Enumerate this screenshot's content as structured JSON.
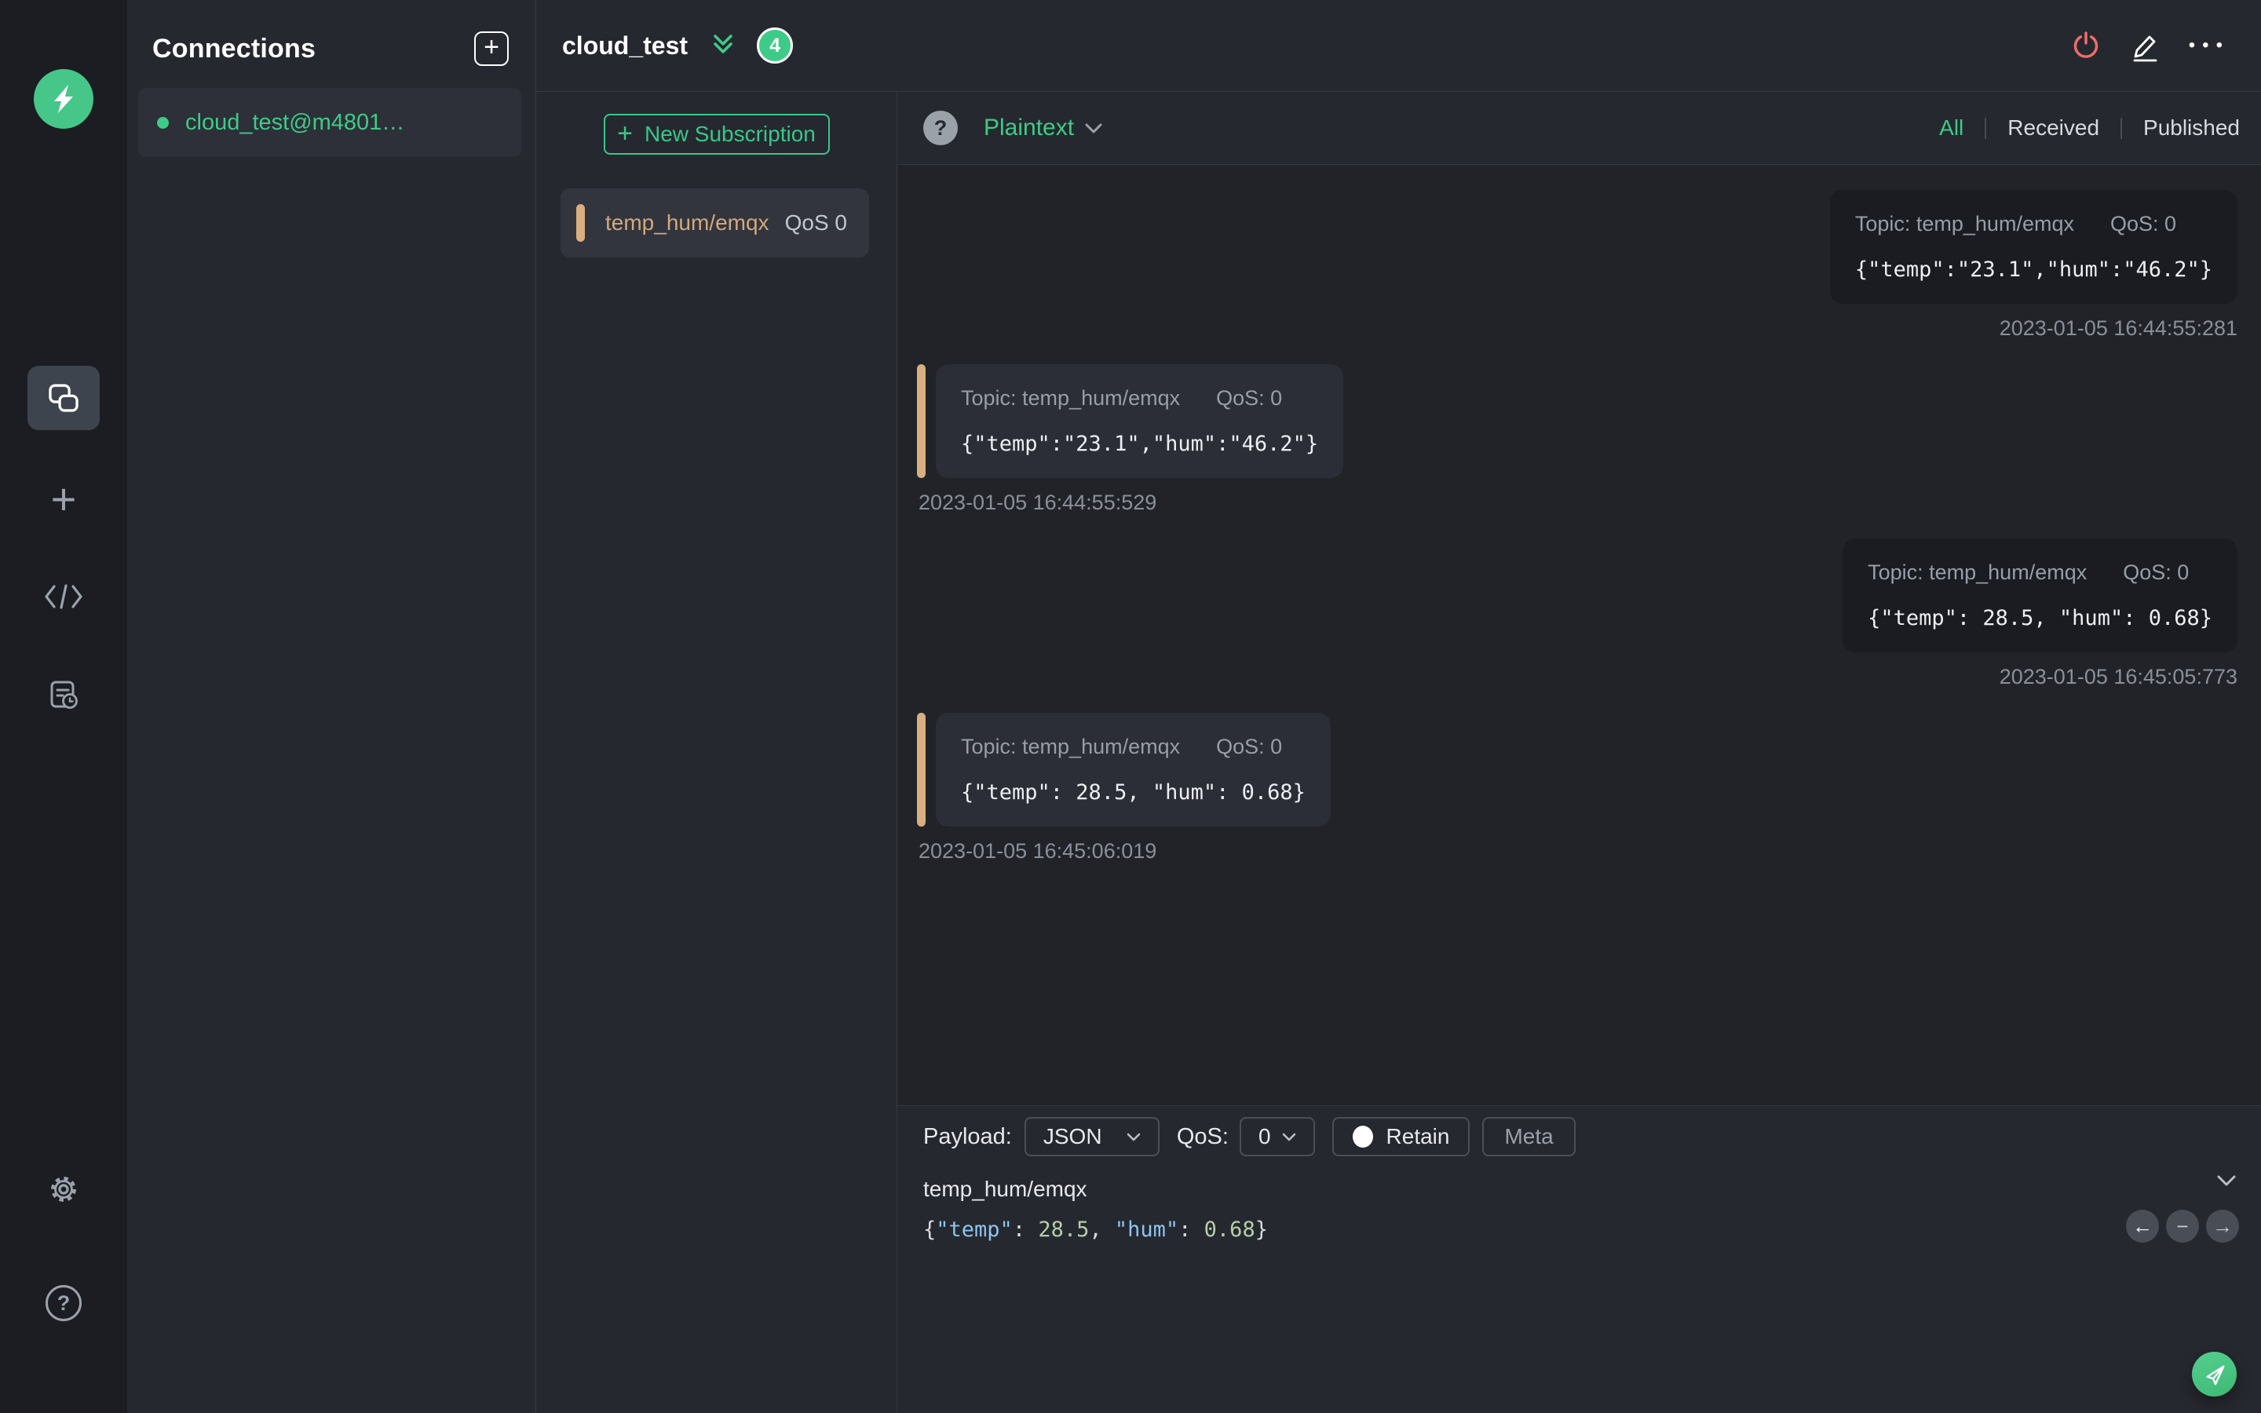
{
  "colors": {
    "accent_green": "#3ecb87",
    "topic_highlight": "#d2a97c",
    "danger_red": "#ed6d68",
    "syntax_key": "#8cc6ef",
    "syntax_number": "#b5cea8"
  },
  "icons": {
    "add": "+",
    "help": "?",
    "more": "•••",
    "back": "←",
    "minus": "−",
    "forward": "→"
  },
  "connections": {
    "title": "Connections",
    "items": [
      {
        "name": "cloud_test@m4801…",
        "status": "connected"
      }
    ]
  },
  "header": {
    "connection_name": "cloud_test",
    "unread_badge": "4"
  },
  "subscriptions": {
    "new_button_label": "New Subscription",
    "items": [
      {
        "topic": "temp_hum/emqx",
        "qos": "QoS 0"
      }
    ]
  },
  "messages": {
    "toolbar": {
      "format": "Plaintext",
      "filters": {
        "all": "All",
        "received": "Received",
        "published": "Published"
      },
      "active_filter": "All"
    },
    "items": [
      {
        "direction": "published",
        "topic": "Topic: temp_hum/emqx",
        "qos": "QoS: 0",
        "payload": "{\"temp\":\"23.1\",\"hum\":\"46.2\"}",
        "timestamp": "2023-01-05 16:44:55:281"
      },
      {
        "direction": "received",
        "topic": "Topic: temp_hum/emqx",
        "qos": "QoS: 0",
        "payload": "{\"temp\":\"23.1\",\"hum\":\"46.2\"}",
        "timestamp": "2023-01-05 16:44:55:529"
      },
      {
        "direction": "published",
        "topic": "Topic: temp_hum/emqx",
        "qos": "QoS: 0",
        "payload": "{\"temp\": 28.5, \"hum\": 0.68}",
        "timestamp": "2023-01-05 16:45:05:773"
      },
      {
        "direction": "received",
        "topic": "Topic: temp_hum/emqx",
        "qos": "QoS: 0",
        "payload": "{\"temp\": 28.5, \"hum\": 0.68}",
        "timestamp": "2023-01-05 16:45:06:019"
      }
    ]
  },
  "publish": {
    "payload_label": "Payload:",
    "payload_format": "JSON",
    "qos_label": "QoS:",
    "qos_value": "0",
    "retain_label": "Retain",
    "meta_label": "Meta",
    "topic": "temp_hum/emqx",
    "editor_tokens": [
      {
        "type": "punct",
        "text": "{"
      },
      {
        "type": "key",
        "text": "\"temp\""
      },
      {
        "type": "punct",
        "text": ": "
      },
      {
        "type": "num",
        "text": "28.5"
      },
      {
        "type": "punct",
        "text": ", "
      },
      {
        "type": "key",
        "text": "\"hum\""
      },
      {
        "type": "punct",
        "text": ": "
      },
      {
        "type": "num",
        "text": "0.68"
      },
      {
        "type": "punct",
        "text": "}"
      }
    ]
  }
}
